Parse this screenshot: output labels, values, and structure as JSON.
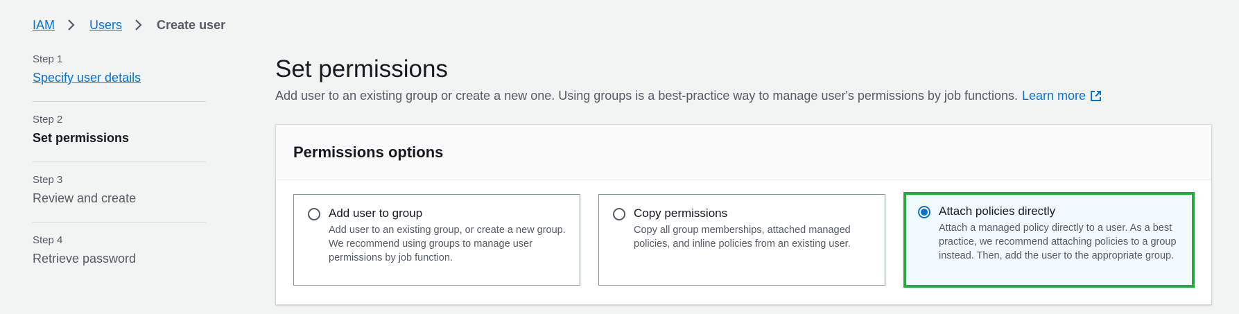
{
  "breadcrumb": {
    "items": [
      "IAM",
      "Users"
    ],
    "current": "Create user"
  },
  "steps": [
    {
      "num": "Step 1",
      "title": "Specify user details",
      "state": "link"
    },
    {
      "num": "Step 2",
      "title": "Set permissions",
      "state": "active"
    },
    {
      "num": "Step 3",
      "title": "Review and create",
      "state": "inactive"
    },
    {
      "num": "Step 4",
      "title": "Retrieve password",
      "state": "inactive"
    }
  ],
  "main": {
    "title": "Set permissions",
    "description": "Add user to an existing group or create a new one. Using groups is a best-practice way to manage user's permissions by job functions.",
    "learn_more": "Learn more"
  },
  "panel": {
    "title": "Permissions options",
    "options": [
      {
        "title": "Add user to group",
        "desc": "Add user to an existing group, or create a new group. We recommend using groups to manage user permissions by job function.",
        "selected": false
      },
      {
        "title": "Copy permissions",
        "desc": "Copy all group memberships, attached managed policies, and inline policies from an existing user.",
        "selected": false
      },
      {
        "title": "Attach policies directly",
        "desc": "Attach a managed policy directly to a user. As a best practice, we recommend attaching policies to a group instead. Then, add the user to the appropriate group.",
        "selected": true
      }
    ]
  },
  "colors": {
    "link": "#0972d3",
    "highlight": "#28a745",
    "selected_bg": "#f1faff"
  },
  "icons": [
    "chevron-right-icon",
    "external-link-icon",
    "radio-icon"
  ]
}
